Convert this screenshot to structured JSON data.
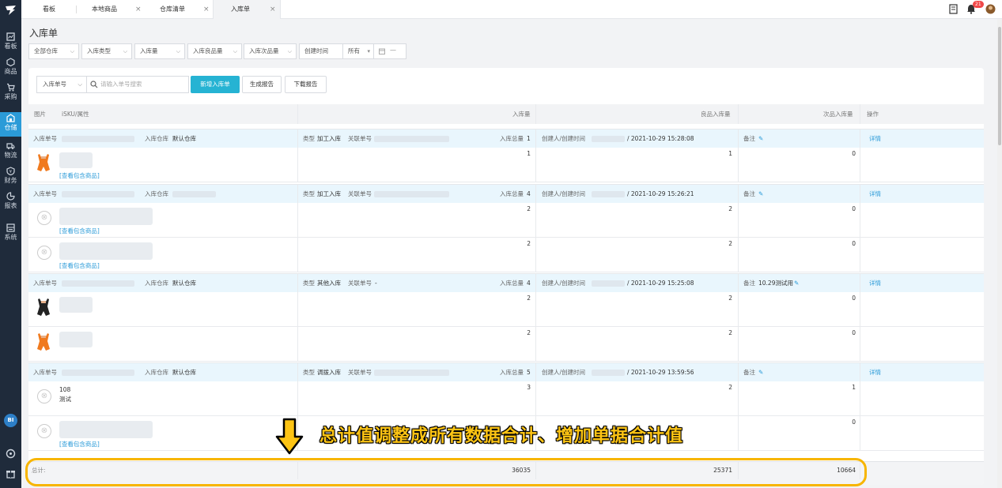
{
  "sidebar": {
    "items": [
      {
        "label": "看板",
        "icon": "dashboard-icon"
      },
      {
        "label": "商品",
        "icon": "box-icon"
      },
      {
        "label": "采购",
        "icon": "cart-icon"
      },
      {
        "label": "仓储",
        "icon": "warehouse-icon",
        "active": true
      },
      {
        "label": "物流",
        "icon": "truck-icon"
      },
      {
        "label": "财务",
        "icon": "finance-icon"
      },
      {
        "label": "报表",
        "icon": "report-icon"
      },
      {
        "label": "系统",
        "icon": "system-icon"
      }
    ],
    "bi_label": "BI"
  },
  "tabs": [
    {
      "label": "看板",
      "closable": false
    },
    {
      "label": "本地商品",
      "closable": true
    },
    {
      "label": "仓库清单",
      "closable": true
    },
    {
      "label": "入库单",
      "closable": true,
      "active": true
    }
  ],
  "header": {
    "notification_count": "21"
  },
  "page_title": "入库单",
  "filters": {
    "warehouse": "全部仓库",
    "type": "入库类型",
    "quantity": "入库量",
    "good_qty": "入库良品量",
    "defect_qty": "入库次品量",
    "time_label": "创建时间",
    "time_range": "所有",
    "date_placeholder": "—"
  },
  "toolbar": {
    "search_field": "入库单号",
    "search_placeholder": "请输入单号搜索",
    "new_button": "新增入库单",
    "report_button": "生成报告",
    "download_button": "下载报告"
  },
  "table": {
    "headers": {
      "image": "图片",
      "sku": "iSKU/属性",
      "qty": "入库量",
      "good": "良品入库量",
      "defect": "次品入库量",
      "ops": "操作"
    },
    "group_labels": {
      "order_no": "入库单号",
      "warehouse": "入库仓库",
      "type": "类型",
      "ref": "关联单号",
      "total": "入库总量",
      "creator": "创建人/创建时间",
      "remark": "备注",
      "detail": "详情",
      "view_items": "[查看包含商品]"
    },
    "groups": [
      {
        "warehouse": "默认仓库",
        "type": "加工入库",
        "ref": "",
        "total": "1",
        "time": "/ 2021-10-29 15:28:08",
        "remark": "",
        "items": [
          {
            "sku": "",
            "qty": "1",
            "good": "1",
            "defect": "0",
            "view": true,
            "img": "orange"
          }
        ]
      },
      {
        "warehouse": "",
        "type": "加工入库",
        "ref": "",
        "total": "4",
        "time": "/ 2021-10-29 15:26:21",
        "remark": "",
        "items": [
          {
            "sku": "",
            "qty": "2",
            "good": "2",
            "defect": "0",
            "view": true,
            "img": "none"
          },
          {
            "sku": "",
            "qty": "2",
            "good": "2",
            "defect": "0",
            "view": true,
            "img": "none"
          }
        ]
      },
      {
        "warehouse": "默认仓库",
        "type": "其他入库",
        "ref": "-",
        "total": "4",
        "time": "/ 2021-10-29 15:25:08",
        "remark": "10.29测试用",
        "items": [
          {
            "sku": "",
            "qty": "2",
            "good": "2",
            "defect": "0",
            "view": false,
            "img": "black"
          },
          {
            "sku": "",
            "qty": "2",
            "good": "2",
            "defect": "0",
            "view": false,
            "img": "orange"
          }
        ]
      },
      {
        "warehouse": "默认仓库",
        "type": "调拨入库",
        "ref": "",
        "total": "5",
        "time": "/ 2021-10-29 13:59:56",
        "remark": "",
        "items": [
          {
            "sku": "108",
            "sku2": "测试",
            "qty": "3",
            "good": "2",
            "defect": "1",
            "view": false,
            "img": "none"
          },
          {
            "sku": "",
            "qty": "",
            "good": "",
            "defect": "0",
            "view": true,
            "img": "none"
          }
        ]
      }
    ]
  },
  "totals": {
    "label": "总计:",
    "qty": "36035",
    "good": "25371",
    "defect": "10664"
  },
  "annotation": {
    "text": "总计值调整成所有数据合计、增加单据合计值",
    "color": "#f7b500"
  }
}
